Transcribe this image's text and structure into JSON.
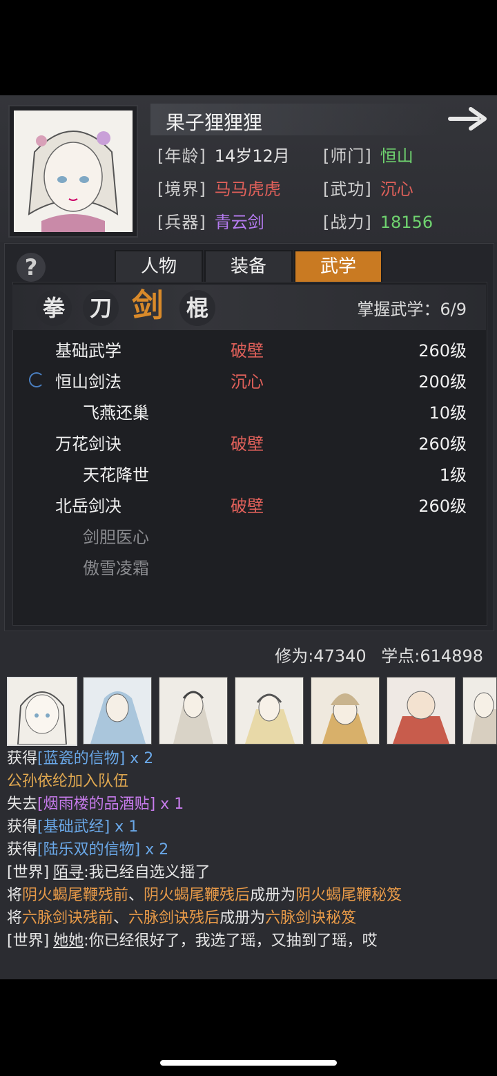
{
  "profile": {
    "name": "果子狸狸狸",
    "attrs": [
      {
        "key": "[年龄]",
        "value": "14岁12月",
        "color": "#e6e6e6"
      },
      {
        "key": "[师门]",
        "value": "恒山",
        "color": "#6fd36f"
      },
      {
        "key": "[境界]",
        "value": "马马虎虎",
        "color": "#e0605a"
      },
      {
        "key": "[武功]",
        "value": "沉心",
        "color": "#e0605a"
      },
      {
        "key": "[兵器]",
        "value": "青云剑",
        "color": "#b57bf0"
      },
      {
        "key": "[战力]",
        "value": "18156",
        "color": "#6fd36f"
      }
    ]
  },
  "tabs": [
    "人物",
    "装备",
    "武学"
  ],
  "active_tab": "武学",
  "help_label": "?",
  "categories": [
    "拳",
    "刀",
    "剑",
    "棍"
  ],
  "active_category": "剑",
  "mastery": "掌握武学：6/9",
  "skills": [
    {
      "name": "基础武学",
      "rank": "破壁",
      "level": "260级",
      "sub": false,
      "dim": false
    },
    {
      "name": "恒山剑法",
      "rank": "沉心",
      "level": "200级",
      "sub": false,
      "dim": false,
      "equipped": true
    },
    {
      "name": "飞燕还巢",
      "rank": "",
      "level": "10级",
      "sub": true,
      "dim": false
    },
    {
      "name": "万花剑诀",
      "rank": "破壁",
      "level": "260级",
      "sub": false,
      "dim": false
    },
    {
      "name": "天花降世",
      "rank": "",
      "level": "1级",
      "sub": true,
      "dim": false
    },
    {
      "name": "北岳剑决",
      "rank": "破壁",
      "level": "260级",
      "sub": false,
      "dim": false
    },
    {
      "name": "剑胆医心",
      "rank": "",
      "level": "",
      "sub": true,
      "dim": true
    },
    {
      "name": "傲雪凌霜",
      "rank": "",
      "level": "",
      "sub": true,
      "dim": true
    }
  ],
  "stats": {
    "cultivation": "修为:47340",
    "points": "学点:614898"
  },
  "log": {
    "l1": {
      "a": "获得",
      "b": "[蓝瓷的信物]",
      "c": " x 2"
    },
    "l2": {
      "a": "公孙依纶加入队伍"
    },
    "l3": {
      "a": "失去",
      "b": "[烟雨楼的品酒贴]",
      "c": " x 1"
    },
    "l4": {
      "a": "获得",
      "b": "[基础武经]",
      "c": " x 1"
    },
    "l5": {
      "a": "获得",
      "b": "[陆乐双的信物]",
      "c": " x 2"
    },
    "l6": {
      "a": "[世界]",
      "b": "陌寻",
      "c": ":我已经自选义摇了"
    },
    "l7": {
      "a": "将",
      "b": "阴火蝎尾鞭残前",
      "c": "、",
      "d": "阴火蝎尾鞭残后",
      "e": "成册为",
      "f": "阴火蝎尾鞭秘笈"
    },
    "l8": {
      "a": "将",
      "b": "六脉剑诀残前",
      "c": "、",
      "d": "六脉剑诀残后",
      "e": "成册为",
      "f": "六脉剑诀秘笈"
    },
    "l9": {
      "a": "[世界]",
      "b": "她她",
      "c": ":你已经很好了，我选了瑶，又抽到了瑶，哎"
    }
  }
}
